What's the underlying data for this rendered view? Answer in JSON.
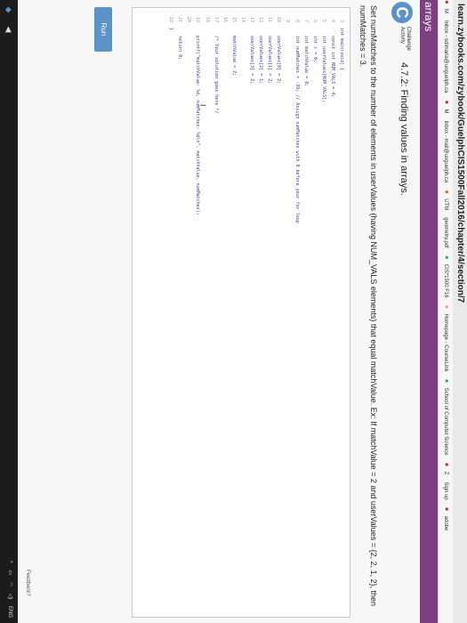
{
  "browser": {
    "url": "learn.zybooks.com/zybook/GuelphCIS1500Fall2016/chapter/4/section/7",
    "bookmarks": [
      {
        "label": "M",
        "color": "#c33"
      },
      {
        "label": "Inbox - sdimaria@uoguelph.ca",
        "color": ""
      },
      {
        "label": "M",
        "color": "#c33"
      },
      {
        "label": "Inbox - mail@uoguelph.ca",
        "color": ""
      },
      {
        "label": "UTM",
        "color": "#d63"
      },
      {
        "label": "geometry.pdf",
        "color": ""
      },
      {
        "label": "CIS*1500 F16",
        "color": "#3a7"
      },
      {
        "label": "Homepage - CourseLink",
        "color": "#f9a"
      },
      {
        "label": "School of Computer Science",
        "color": "#3a7"
      },
      {
        "label": "Z",
        "color": "#c33"
      },
      {
        "label": "Sign up",
        "color": ""
      },
      {
        "label": "adobe",
        "color": "#c33"
      }
    ]
  },
  "section": {
    "title": "arrays"
  },
  "activity": {
    "badge_letter": "C",
    "badge_line1": "Challenge",
    "badge_line2": "Activity",
    "title": "4.7.2: Finding values in arrays.",
    "instruction": "Set numMatches to the number of elements in userValues (having NUM_VALS elements) that equal matchValue. Ex: If matchValue = 2 and userValues = {2, 2, 1, 2}, then numMatches = 3."
  },
  "code": [
    {
      "n": "3",
      "t": "int main(void) {"
    },
    {
      "n": "4",
      "t": "   const int NUM_VALS = 4;"
    },
    {
      "n": "5",
      "t": "   int userValues[NUM_VALS];"
    },
    {
      "n": "6",
      "t": "   int i = 0;"
    },
    {
      "n": "7",
      "t": "   int matchValue = 0;"
    },
    {
      "n": "8",
      "t": "   int numMatches = -99; // Assign numMatches with 0 before your for loop"
    },
    {
      "n": "9",
      "t": ""
    },
    {
      "n": "10",
      "t": "   userValues[0] = 2;"
    },
    {
      "n": "11",
      "t": "   userValues[1] = 2;"
    },
    {
      "n": "12",
      "t": "   userValues[2] = 1;"
    },
    {
      "n": "13",
      "t": "   userValues[3] = 2;"
    },
    {
      "n": "14",
      "t": ""
    },
    {
      "n": "15",
      "t": "   matchValue = 2;"
    },
    {
      "n": "16",
      "t": ""
    },
    {
      "n": "17",
      "t": "   /* Your solution goes here */"
    },
    {
      "n": "18",
      "t": ""
    },
    {
      "n": "19",
      "t": "   printf(\"matchValue: %d, numMatches: %d\\n\", matchValue, numMatches);"
    },
    {
      "n": "20",
      "t": ""
    },
    {
      "n": "21",
      "t": "   return 0;"
    },
    {
      "n": "22",
      "t": "}"
    }
  ],
  "run_button": "Run",
  "feedback": "Feedback?",
  "taskbar": {
    "lang": "ENG"
  }
}
